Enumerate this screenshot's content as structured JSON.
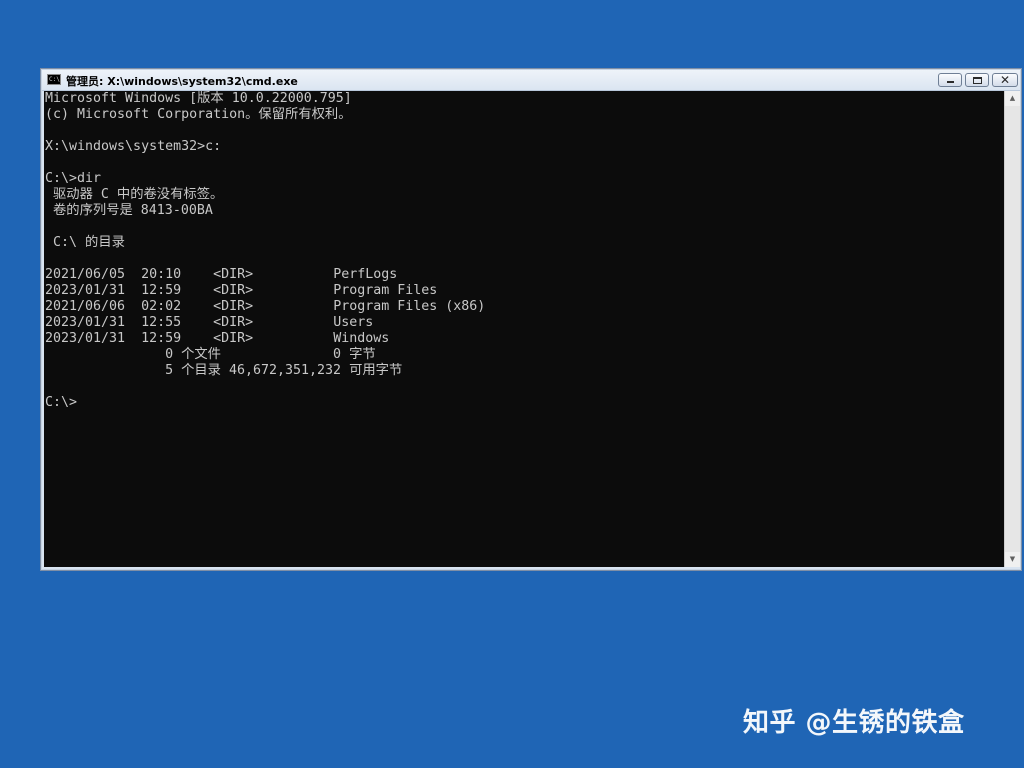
{
  "window": {
    "title": "管理员: X:\\windows\\system32\\cmd.exe",
    "icon": "cmd-console-icon",
    "icon_label": "C:\\"
  },
  "caption_buttons": {
    "minimize_icon": "minimize-icon",
    "maximize_icon": "maximize-icon",
    "close_icon": "close-icon",
    "close_glyph": "✕"
  },
  "console": {
    "lines": [
      "Microsoft Windows [版本 10.0.22000.795]",
      "(c) Microsoft Corporation。保留所有权利。",
      "",
      "X:\\windows\\system32>c:",
      "",
      "C:\\>dir",
      " 驱动器 C 中的卷没有标签。",
      " 卷的序列号是 8413-00BA",
      "",
      " C:\\ 的目录",
      "",
      "2021/06/05  20:10    <DIR>          PerfLogs",
      "2023/01/31  12:59    <DIR>          Program Files",
      "2021/06/06  02:02    <DIR>          Program Files (x86)",
      "2023/01/31  12:55    <DIR>          Users",
      "2023/01/31  12:59    <DIR>          Windows",
      "               0 个文件              0 字节",
      "               5 个目录 46,672,351,232 可用字节",
      "",
      "C:\\>"
    ]
  },
  "scrollbar": {
    "up_arrow": "▲",
    "down_arrow": "▼"
  },
  "watermark": {
    "text": "知乎 @生锈的铁盒"
  },
  "colors": {
    "desktop": "#1f65b5",
    "console_bg": "#0c0c0c",
    "console_fg": "#c8c8c8"
  }
}
